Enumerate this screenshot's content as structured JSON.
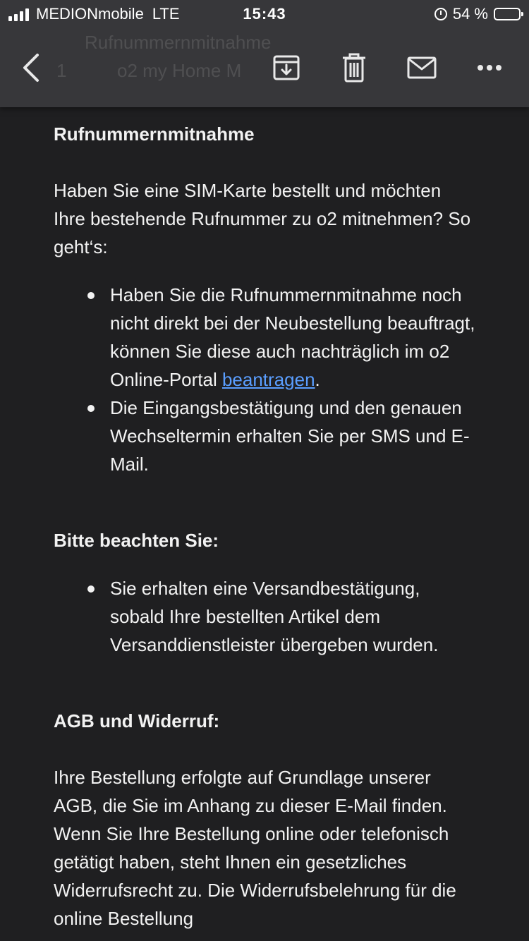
{
  "status_bar": {
    "carrier": "MEDIONmobile",
    "network": "LTE",
    "time": "15:43",
    "battery": "54 %",
    "battery_level": 0.54,
    "battery_color": "#f5cc17"
  },
  "toolbar": {
    "ghost_subject_line1": "Rufnummernmitnahme",
    "ghost_count": "1",
    "ghost_sender": "o2 my Home M",
    "icons": [
      "back-chevron-icon",
      "archive-icon",
      "trash-icon",
      "mail-icon",
      "more-icon"
    ]
  },
  "email": {
    "section1_heading": "Rufnummernmitnahme",
    "section1_intro": "Haben Sie eine SIM-Karte bestellt und möchten Ihre bestehende Rufnummer zu o2 mitnehmen? So geht‘s:",
    "section1_item1_text": "Haben Sie die Rufnummernmitnahme noch nicht direkt bei der Neubestellung beauftragt, können Sie diese auch nachträglich im o2 Online-Portal ",
    "section1_item1_link": "beantragen",
    "section1_item1_end": ".",
    "section1_item2": "Die Eingangsbestätigung und den genauen Wechseltermin erhalten Sie per SMS und E-Mail.",
    "section2_heading": "Bitte beachten Sie:",
    "section2_item1": "Sie erhalten eine Versandbestätigung, sobald Ihre bestellten Artikel dem Versanddienstleister übergeben wurden.",
    "section3_heading": "AGB und Widerruf:",
    "section3_text": "Ihre Bestellung erfolgte auf Grundlage unserer AGB, die Sie im Anhang zu dieser E-Mail finden. Wenn Sie Ihre Bestellung online oder telefonisch getätigt haben, steht Ihnen ein gesetzliches Widerrufsrecht zu. Die Widerrufsbelehrung für die online Bestellung"
  },
  "colors": {
    "background": "#1f1f21",
    "toolbar": "#37373a",
    "link": "#5a9eff"
  }
}
